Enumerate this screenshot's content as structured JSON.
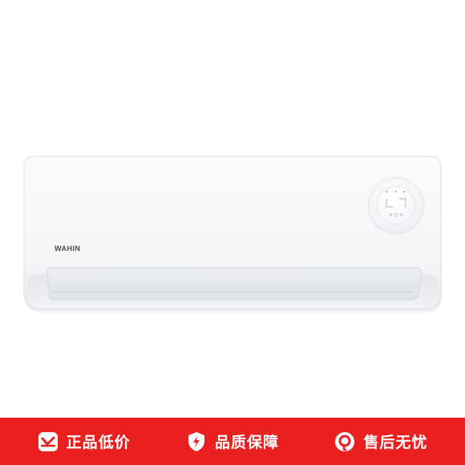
{
  "product": {
    "brand_logo": "WAHIN"
  },
  "promo_bar": {
    "background_color": "#ea1f1f",
    "items": [
      {
        "label": "正品低价",
        "icon": "price-tag-icon"
      },
      {
        "label": "品质保障",
        "icon": "shield-bolt-icon"
      },
      {
        "label": "售后无忧",
        "icon": "service-headset-icon"
      }
    ]
  }
}
